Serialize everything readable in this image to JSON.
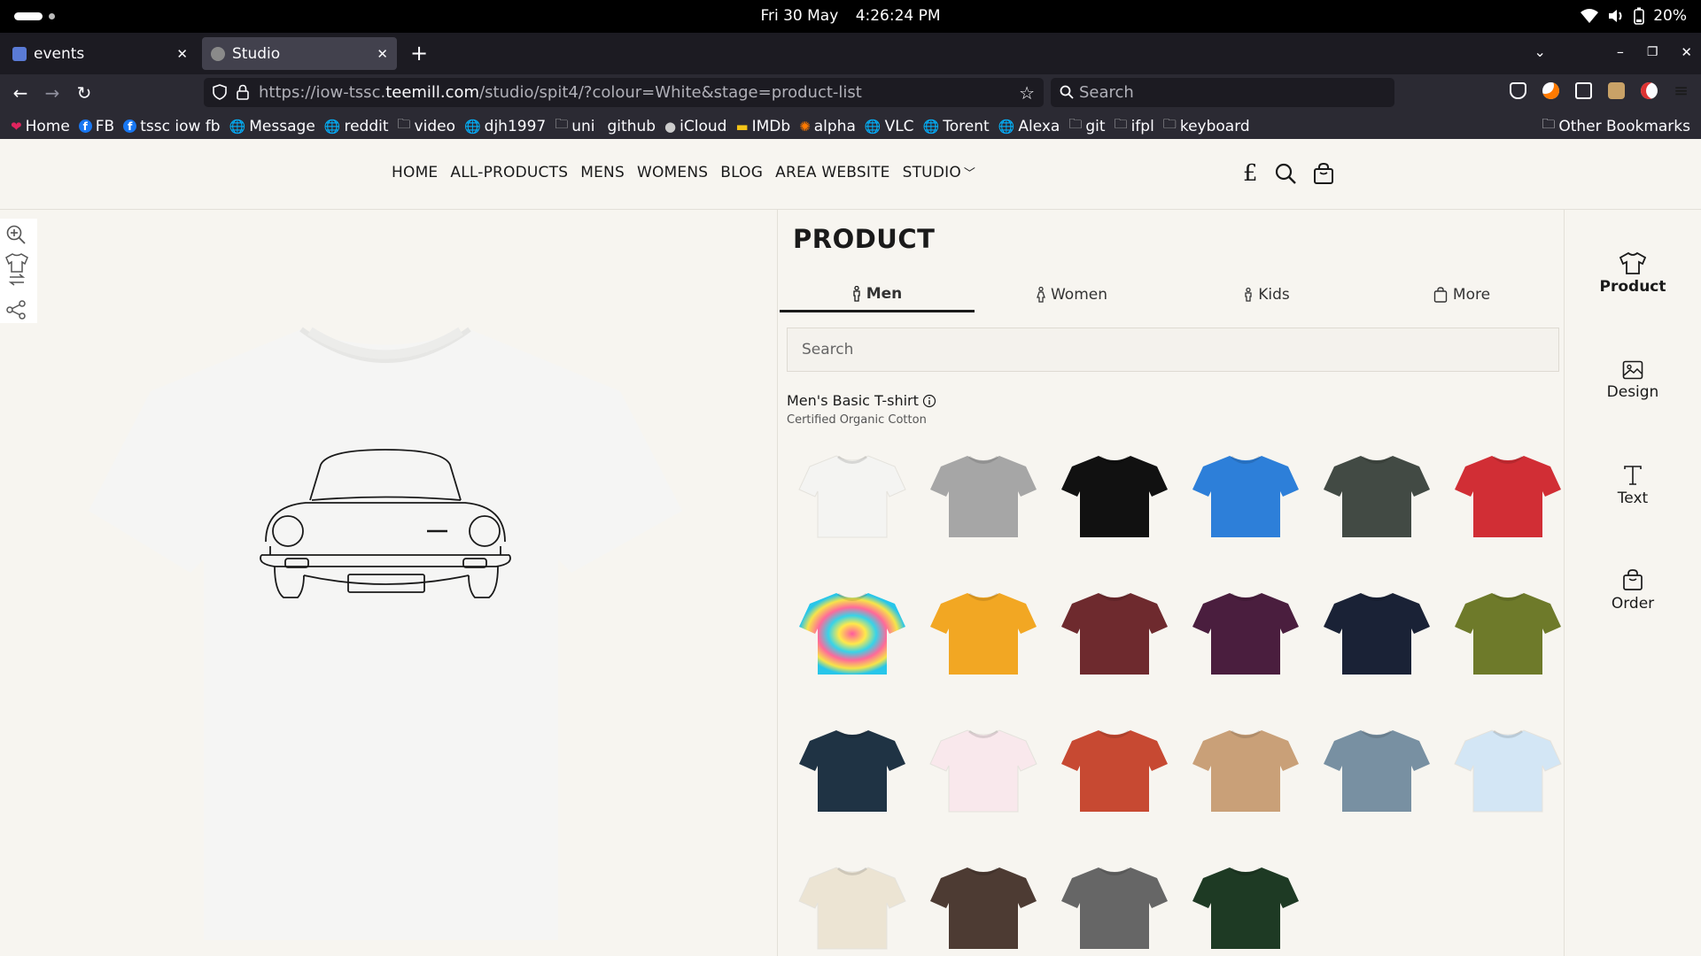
{
  "os": {
    "date": "Fri 30 May",
    "time": "4:26:24 PM",
    "battery": "20%"
  },
  "browser": {
    "tabs": [
      {
        "title": "events",
        "active": false,
        "fav_color": "#5a7bd6"
      },
      {
        "title": "Studio",
        "active": true,
        "fav_color": "#8a8a8a"
      }
    ],
    "url_prefix": "https://iow-tssc.",
    "url_domain": "teemill.com",
    "url_suffix": "/studio/spit4/?colour=White&stage=product-list",
    "search_placeholder": "Search",
    "bookmarks": [
      {
        "label": "Home",
        "icon": "heart-icon",
        "glyph": "❤",
        "color": "#e0245e"
      },
      {
        "label": "FB",
        "icon": "facebook-icon",
        "glyph": "f",
        "color": "#1877f2"
      },
      {
        "label": "tssc iow fb",
        "icon": "facebook-icon",
        "glyph": "f",
        "color": "#1877f2"
      },
      {
        "label": "Message",
        "icon": "globe-icon",
        "glyph": "🌐",
        "color": "#ddd"
      },
      {
        "label": "reddit",
        "icon": "globe-icon",
        "glyph": "🌐",
        "color": "#ddd"
      },
      {
        "label": "video",
        "icon": "folder-icon",
        "glyph": "🗀",
        "color": "#ddd"
      },
      {
        "label": "djh1997",
        "icon": "globe-icon",
        "glyph": "🌐",
        "color": "#ddd"
      },
      {
        "label": "uni",
        "icon": "folder-icon",
        "glyph": "🗀",
        "color": "#ddd"
      },
      {
        "label": "github",
        "icon": "github-icon",
        "glyph": " ",
        "color": "#ddd"
      },
      {
        "label": "iCloud",
        "icon": "apple-icon",
        "glyph": "●",
        "color": "#ccc"
      },
      {
        "label": "IMDb",
        "icon": "imdb-icon",
        "glyph": "▬",
        "color": "#f5c518"
      },
      {
        "label": "alpha",
        "icon": "alpha-icon",
        "glyph": "✺",
        "color": "#ff7a00"
      },
      {
        "label": "VLC",
        "icon": "globe-icon",
        "glyph": "🌐",
        "color": "#ddd"
      },
      {
        "label": "Torent",
        "icon": "globe-icon",
        "glyph": "🌐",
        "color": "#ddd"
      },
      {
        "label": "Alexa",
        "icon": "globe-icon",
        "glyph": "🌐",
        "color": "#ddd"
      },
      {
        "label": "git",
        "icon": "folder-icon",
        "glyph": "🗀",
        "color": "#ddd"
      },
      {
        "label": "ifpl",
        "icon": "folder-icon",
        "glyph": "🗀",
        "color": "#ddd"
      },
      {
        "label": "keyboard",
        "icon": "folder-icon",
        "glyph": "🗀",
        "color": "#ddd"
      }
    ],
    "other_bookmarks": "Other Bookmarks"
  },
  "site": {
    "nav": [
      "HOME",
      "ALL-PRODUCTS",
      "MENS",
      "WOMENS",
      "BLOG",
      "AREA WEBSITE",
      "STUDIO"
    ],
    "currency": "£"
  },
  "panel": {
    "title": "PRODUCT",
    "tabs": [
      {
        "label": "Men",
        "icon": "man-icon",
        "active": true
      },
      {
        "label": "Women",
        "icon": "woman-icon",
        "active": false
      },
      {
        "label": "Kids",
        "icon": "child-icon",
        "active": false
      },
      {
        "label": "More",
        "icon": "bag-icon",
        "active": false
      }
    ],
    "search_placeholder": "Search",
    "product_name": "Men's Basic T-shirt",
    "product_sub": "Certified Organic Cotton",
    "colors": [
      "#f4f4f2",
      "#a6a6a6",
      "#111111",
      "#2d7fd9",
      "#424a44",
      "#d12e35",
      "tiedye",
      "#f2a723",
      "#6e2a2e",
      "#4a1e3e",
      "#1a2236",
      "#6e7a2a",
      "#1f3344",
      "#f9e8ec",
      "#c74932",
      "#c9a078",
      "#7890a2",
      "#d3e6f5",
      "#ece4d3",
      "#4d3b33",
      "#666666",
      "#1e3a24"
    ]
  },
  "rail": [
    {
      "label": "Product",
      "icon": "tshirt-icon",
      "active": true
    },
    {
      "label": "Design",
      "icon": "image-icon",
      "active": false
    },
    {
      "label": "Text",
      "icon": "text-icon",
      "active": false
    },
    {
      "label": "Order",
      "icon": "bag-icon",
      "active": false
    }
  ]
}
